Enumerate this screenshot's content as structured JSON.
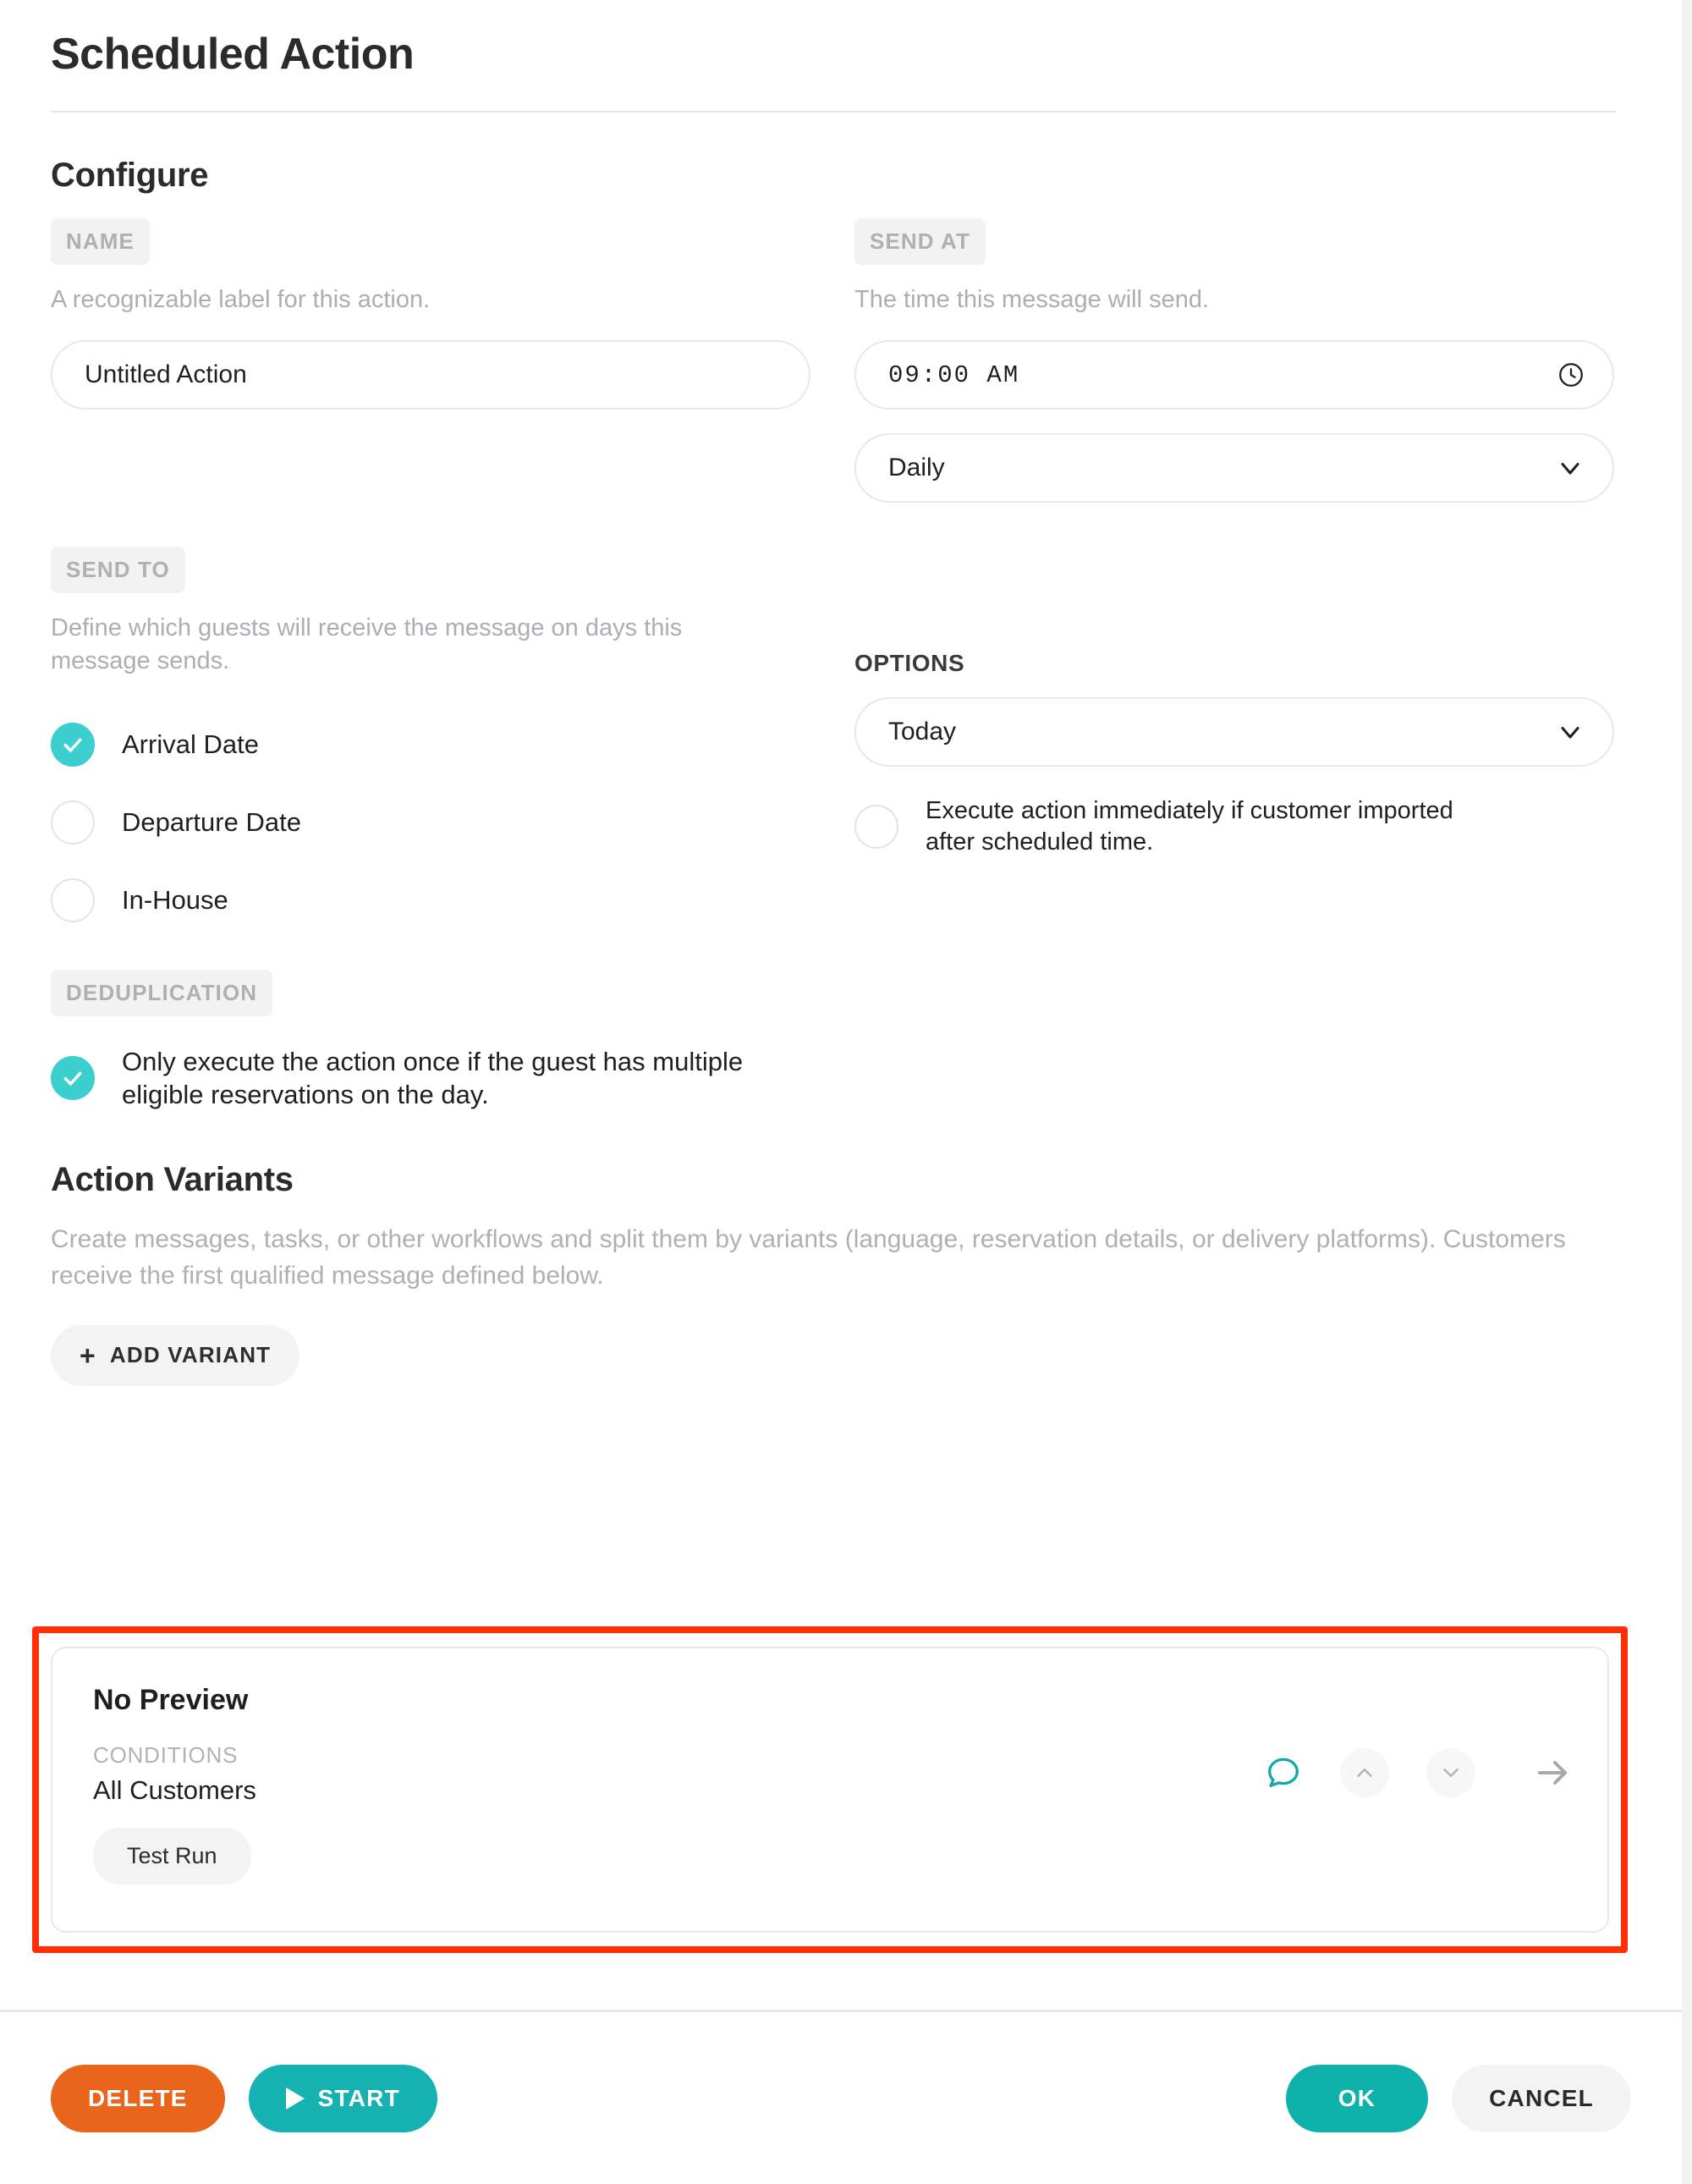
{
  "header": {
    "title": "Scheduled Action"
  },
  "configure": {
    "heading": "Configure",
    "name": {
      "label": "NAME",
      "helper": "A recognizable label for this action.",
      "value": "Untitled Action",
      "placeholder": "Untitled Action"
    },
    "send_at": {
      "label": "SEND AT",
      "helper": "The time this message will send.",
      "time_value": "09:00 AM",
      "frequency_value": "Daily",
      "clock_icon": "clock-icon",
      "chevron_icon": "chevron-down-icon"
    },
    "send_to": {
      "label": "SEND TO",
      "helper": "Define which guests will receive the message on days this message sends.",
      "choices": [
        {
          "label": "Arrival Date",
          "checked": true
        },
        {
          "label": "Departure Date",
          "checked": false
        },
        {
          "label": "In-House",
          "checked": false
        }
      ]
    },
    "options": {
      "label": "OPTIONS",
      "select_value": "Today",
      "chevron_icon": "chevron-down-icon",
      "immediate": {
        "label": "Execute action immediately if customer imported after scheduled time.",
        "checked": false
      }
    },
    "deduplication": {
      "label": "DEDUPLICATION",
      "option": {
        "label": "Only execute the action once if the guest has multiple eligible reservations on the day.",
        "checked": true
      }
    }
  },
  "action_variants": {
    "heading": "Action Variants",
    "description": "Create messages, tasks, or other workflows and split them by variants (language, reservation details, or delivery platforms). Customers receive the first qualified message defined below.",
    "add_variant_label": "ADD VARIANT",
    "add_variant_plus": "+",
    "card": {
      "title": "No Preview",
      "conditions_label": "CONDITIONS",
      "conditions_value": "All Customers",
      "test_run_label": "Test Run",
      "chat_icon": "chat-bubble-icon",
      "move_up_icon": "chevron-up-icon",
      "move_down_icon": "chevron-down-icon",
      "open_icon": "arrow-right-icon"
    }
  },
  "footer": {
    "delete_label": "DELETE",
    "start_label": "START",
    "start_icon": "play-icon",
    "ok_label": "OK",
    "cancel_label": "CANCEL"
  },
  "colors": {
    "teal_check": "#3ccfcf",
    "teal_button": "#16b2b2",
    "teal_ok": "#0fb2ab",
    "orange_delete": "#e8651b",
    "highlight_red": "#ff3008",
    "muted_text": "#b0b0b3"
  }
}
